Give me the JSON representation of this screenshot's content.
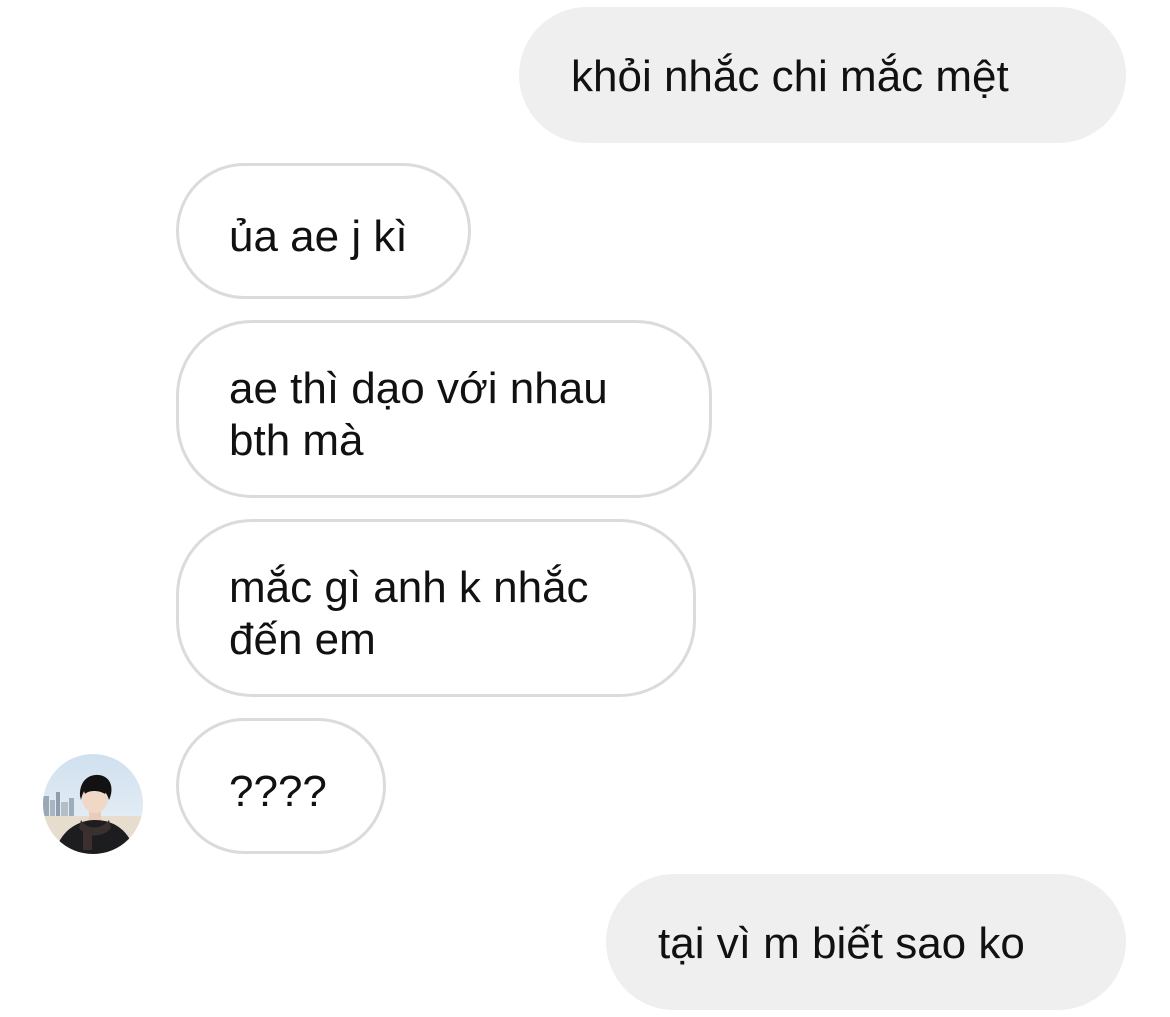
{
  "messages": [
    {
      "direction": "outgoing",
      "text": "khỏi nhắc chi mắc mệt"
    },
    {
      "direction": "incoming",
      "text": "ủa ae j kì"
    },
    {
      "direction": "incoming",
      "text": "ae thì dạo với nhau\nbth mà"
    },
    {
      "direction": "incoming",
      "text": "mắc gì anh k nhắc\nđến em"
    },
    {
      "direction": "incoming",
      "text": "????"
    },
    {
      "direction": "outgoing",
      "text": "tại vì m biết sao ko"
    }
  ],
  "colors": {
    "outgoing_bubble": "#efefef",
    "incoming_border": "#dbdbdb",
    "text": "#111111"
  },
  "icons": {
    "sender_avatar": "profile-photo-avatar"
  }
}
